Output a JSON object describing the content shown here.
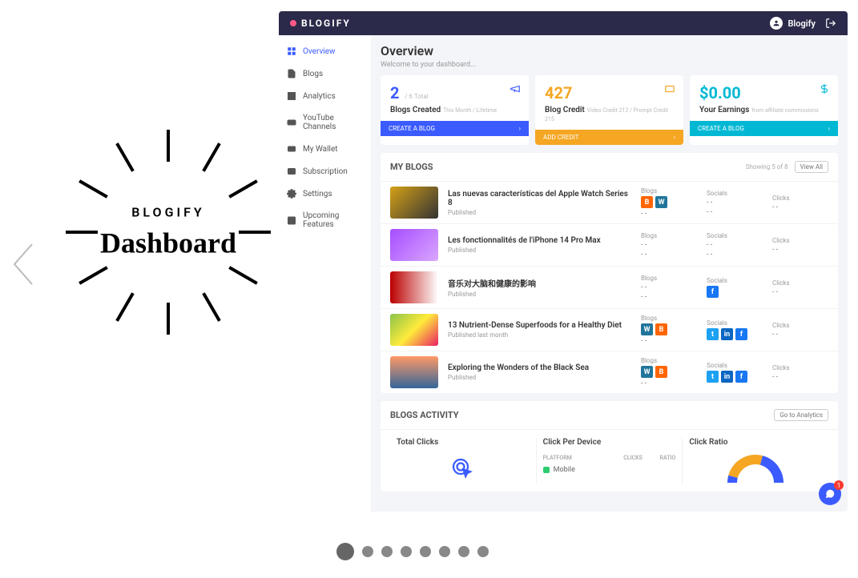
{
  "slide": {
    "brand": "BLOGIFY",
    "title": "Dashboard",
    "dots_total": 8,
    "active_dot": 0
  },
  "header": {
    "brand": "BLOGIFY",
    "username": "Blogify"
  },
  "sidebar": {
    "items": [
      {
        "label": "Overview"
      },
      {
        "label": "Blogs"
      },
      {
        "label": "Analytics"
      },
      {
        "label": "YouTube Channels"
      },
      {
        "label": "My Wallet"
      },
      {
        "label": "Subscription"
      },
      {
        "label": "Settings"
      },
      {
        "label": "Upcoming Features"
      }
    ]
  },
  "page": {
    "title": "Overview",
    "subtitle": "Welcome to your dashboard..."
  },
  "cards": {
    "blogs": {
      "value": "2",
      "suffix": "/ 6 Total",
      "title": "Blogs Created",
      "hint": "This Month / Lifetime",
      "cta": "CREATE A BLOG"
    },
    "credit": {
      "value": "427",
      "title": "Blog Credit",
      "hint": "Video Credit 212 / Prompt Credit 215",
      "cta": "ADD CREDIT"
    },
    "earnings": {
      "value": "$0.00",
      "title": "Your Earnings",
      "hint": "from affiliate commissions",
      "cta": "CREATE A BLOG"
    }
  },
  "myblogs": {
    "title": "MY BLOGS",
    "showing": "Showing 5 of 8",
    "viewall": "View All",
    "labels": {
      "blogs": "Blogs",
      "socials": "Socials",
      "clicks": "Clicks",
      "dash": "- -"
    },
    "rows": [
      {
        "title": "Las nuevas características del Apple Watch Series 8",
        "status": "Published",
        "blogs": [
          "bl",
          "wp"
        ],
        "socials": []
      },
      {
        "title": "Les fonctionnalités de l'iPhone 14 Pro Max",
        "status": "Published",
        "blogs": [],
        "socials": []
      },
      {
        "title": "音乐对大脑和健康的影响",
        "status": "Published",
        "blogs": [],
        "socials": [
          "fb"
        ]
      },
      {
        "title": "13 Nutrient-Dense Superfoods for a Healthy Diet",
        "status": "Published last month",
        "blogs": [
          "wp",
          "bl"
        ],
        "socials": [
          "tw",
          "li",
          "fb"
        ]
      },
      {
        "title": "Exploring the Wonders of the Black Sea",
        "status": "Published",
        "blogs": [
          "wp",
          "bl"
        ],
        "socials": [
          "tw",
          "li",
          "fb"
        ]
      }
    ]
  },
  "activity": {
    "title": "BLOGS ACTIVITY",
    "goto": "Go to Analytics",
    "total_clicks": "Total Clicks",
    "per_device": {
      "title": "Click Per Device",
      "h_platform": "PLATFORM",
      "h_clicks": "CLICKS",
      "h_ratio": "RATIO",
      "row_mobile": "Mobile"
    },
    "ratio": "Click Ratio"
  },
  "chat": {
    "badge": "1"
  }
}
